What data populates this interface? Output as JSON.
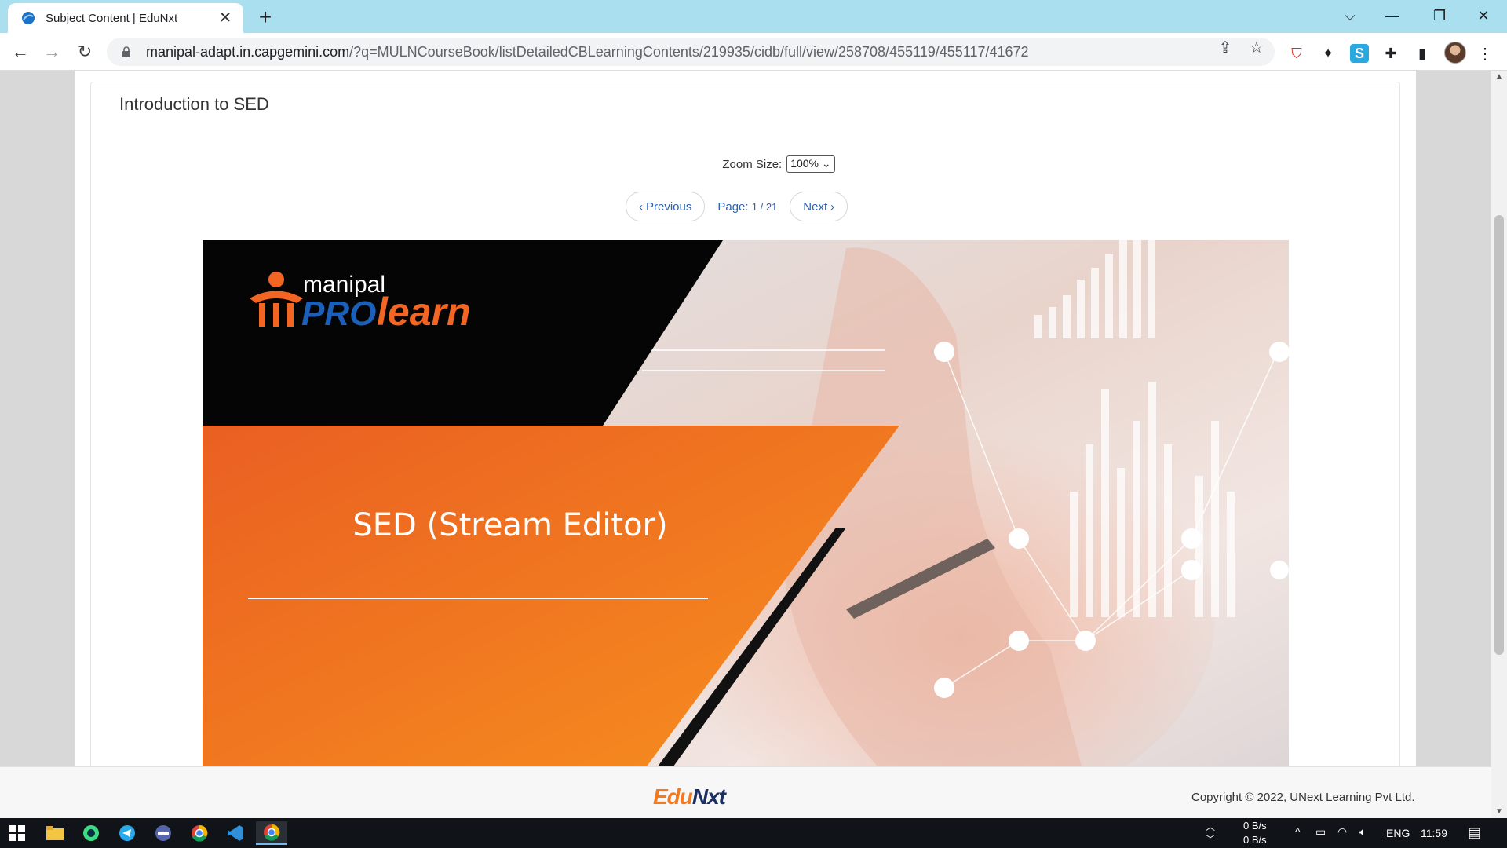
{
  "browser": {
    "tab_title": "Subject Content | EduNxt",
    "url_host": "manipal-adapt.in.capgemini.com",
    "url_path": "/?q=MULNCourseBook/listDetailedCBLearningContents/219935/cidb/full/view/258708/455119/455117/41672"
  },
  "page": {
    "title": "Introduction to SED",
    "zoom_label": "Zoom Size:",
    "zoom_value": "100%",
    "prev_label": "Previous",
    "next_label": "Next",
    "page_label": "Page:",
    "page_current": "1",
    "page_total": "21"
  },
  "slide": {
    "brand_top": "manipal",
    "brand_pro": "PRO",
    "brand_learn": "learn",
    "heading": "SED (Stream Editor)"
  },
  "footer": {
    "logo_edu": "Edu",
    "logo_nxt": "Nxt",
    "copyright": "Copyright © 2022, UNext Learning Pvt Ltd."
  },
  "taskbar": {
    "net_up": "0 B/s",
    "net_down": "0 B/s",
    "language": "ENG",
    "time": "11:59"
  },
  "colors": {
    "tabstrip": "#a9dfee",
    "accent_orange": "#f47a20",
    "link_blue": "#2b63b0",
    "brand_blue": "#1b5fb8"
  }
}
